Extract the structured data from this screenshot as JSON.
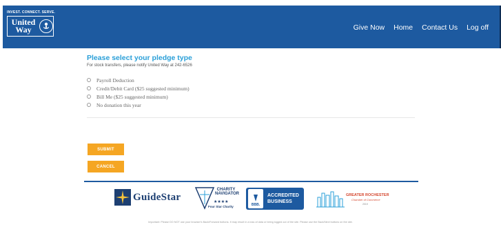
{
  "header": {
    "tagline": "INVEST. CONNECT. SERVE.",
    "logo_line1": "United",
    "logo_line2": "Way",
    "nav": [
      {
        "label": "Give Now"
      },
      {
        "label": "Home"
      },
      {
        "label": "Contact Us"
      },
      {
        "label": "Log off"
      }
    ]
  },
  "form": {
    "title": "Please select your pledge type",
    "subtitle": "For stock transfers, please notify United Way at 242-6526",
    "options": [
      {
        "label": "Payroll Deduction",
        "selected": false
      },
      {
        "label": "Credit/Debit Card ($25 suggested minimum)",
        "selected": false
      },
      {
        "label": "Bill Me ($25 suggested minimum)",
        "selected": false
      },
      {
        "label": "No donation this year",
        "selected": false
      }
    ],
    "submit_label": "SUBMIT",
    "cancel_label": "CANCEL"
  },
  "badges": {
    "guidestar": "GuideStar",
    "charity_top": "CHARITY NAVIGATOR",
    "charity_stars": "★★★★",
    "charity_bottom": "Four Star Charity",
    "bbb_short": "BBB.",
    "bbb_line1": "ACCREDITED",
    "bbb_line2": "BUSINESS",
    "chamber_line1": "GREATER ROCHESTER",
    "chamber_line2": "Chamber of Commerce",
    "chamber_line3": "2019"
  },
  "footer": {
    "disclaimer": "Important: Please DO NOT use your browser's Back/Forward buttons. It may result in a loss of data or being logged out of the site. Please use the Back/Next buttons on the site."
  },
  "colors": {
    "header_bg": "#1d5aa0",
    "title": "#2a9fd8",
    "button": "#f5a623"
  }
}
